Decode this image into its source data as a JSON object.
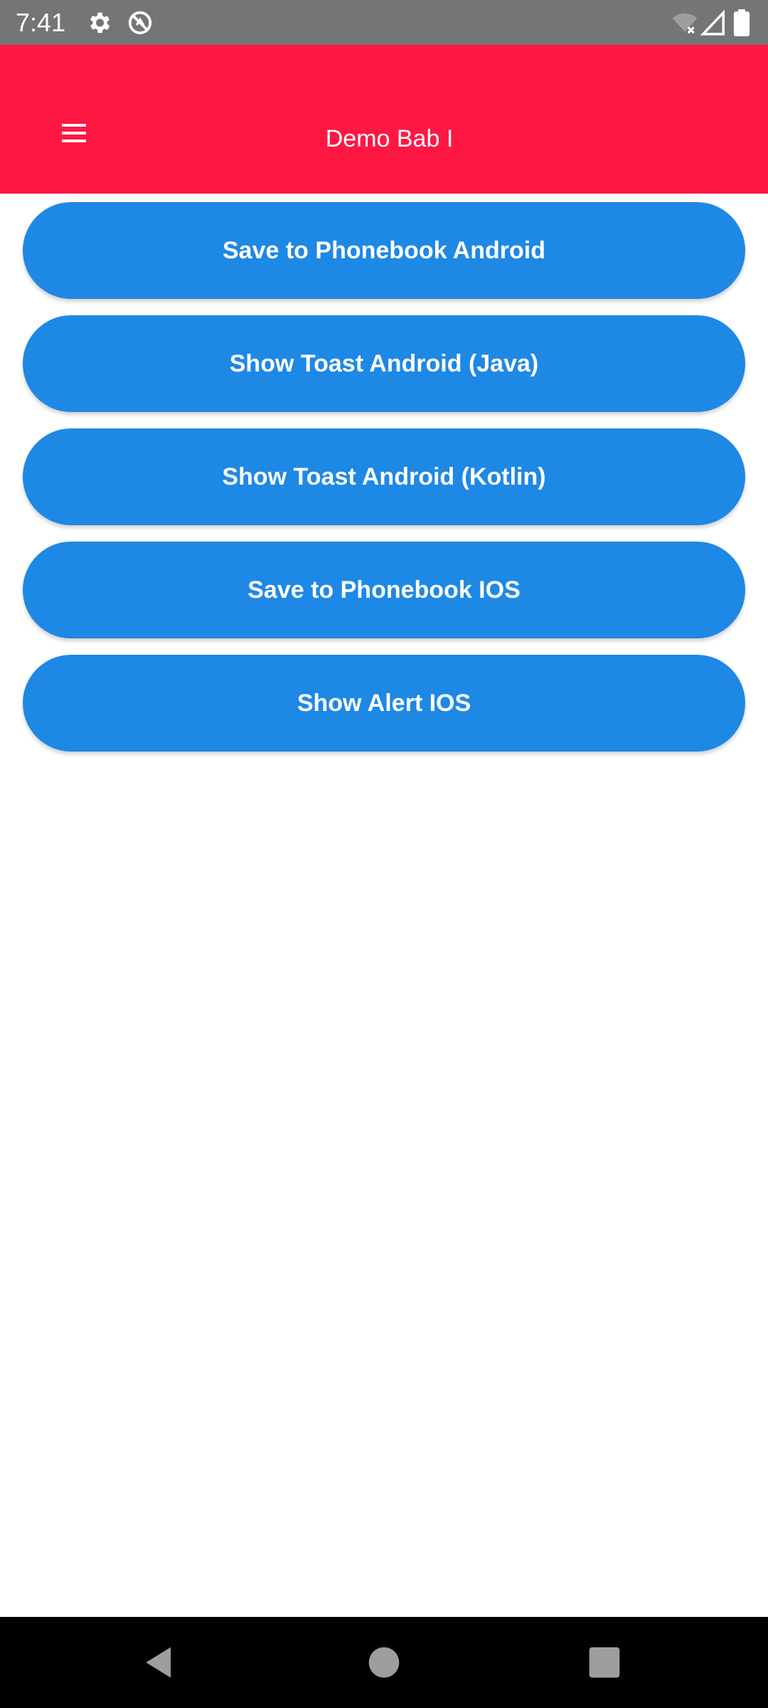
{
  "status_bar": {
    "time": "7:41",
    "left_icons": [
      "gear-icon",
      "no-sync-icon"
    ],
    "right_icons": [
      "wifi-off-icon",
      "signal-icon",
      "battery-icon"
    ]
  },
  "app_bar": {
    "title": "Demo Bab I",
    "menu_icon": "hamburger-menu-icon",
    "color": "#ff1744"
  },
  "buttons": [
    {
      "label": "Save to Phonebook Android"
    },
    {
      "label": "Show Toast Android (Java)"
    },
    {
      "label": "Show Toast Android (Kotlin)"
    },
    {
      "label": "Save to Phonebook IOS"
    },
    {
      "label": "Show Alert IOS"
    }
  ],
  "button_color": "#1e88e5",
  "nav_bar": {
    "icons": [
      "back-icon",
      "home-icon",
      "recents-icon"
    ]
  }
}
